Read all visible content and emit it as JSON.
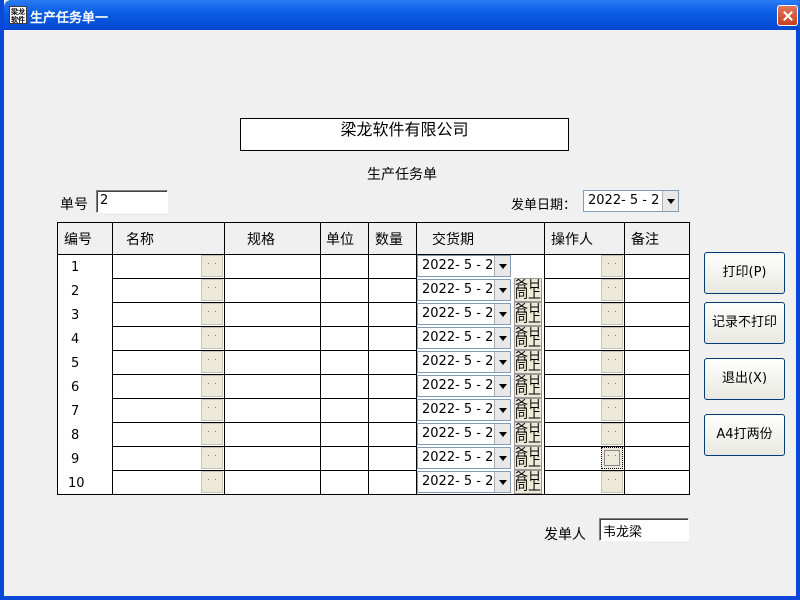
{
  "window": {
    "title": "生产任务单一",
    "app_icon_text": "梁龙软件"
  },
  "company_name": "梁龙软件有限公司",
  "form_title": "生产任务单",
  "order_no": {
    "label": "单号",
    "value": "2"
  },
  "issue_date": {
    "label": "发单日期：",
    "value": "2022- 5 - 2"
  },
  "table": {
    "headers": [
      "编号",
      "名称",
      "规格",
      "单位",
      "数量",
      "交货期",
      "操作人",
      "备注"
    ],
    "rows": [
      {
        "no": "1",
        "due": "2022- 5 - 2"
      },
      {
        "no": "2",
        "due": "2022- 5 - 2"
      },
      {
        "no": "3",
        "due": "2022- 5 - 2"
      },
      {
        "no": "4",
        "due": "2022- 5 - 2"
      },
      {
        "no": "5",
        "due": "2022- 5 - 2"
      },
      {
        "no": "6",
        "due": "2022- 5 - 2"
      },
      {
        "no": "7",
        "due": "2022- 5 - 2"
      },
      {
        "no": "8",
        "due": "2022- 5 - 2"
      },
      {
        "no": "9",
        "due": "2022- 5 - 2"
      },
      {
        "no": "10",
        "due": "2022- 5 - 2"
      }
    ],
    "same_as_above_label": "各日 同上"
  },
  "buttons": {
    "print": "打印(P)",
    "save_no_print": "记录不打印",
    "exit": "退出(X)",
    "a4_print_two": "A4打两份"
  },
  "issuer": {
    "label": "发单人",
    "value": "韦龙梁"
  }
}
